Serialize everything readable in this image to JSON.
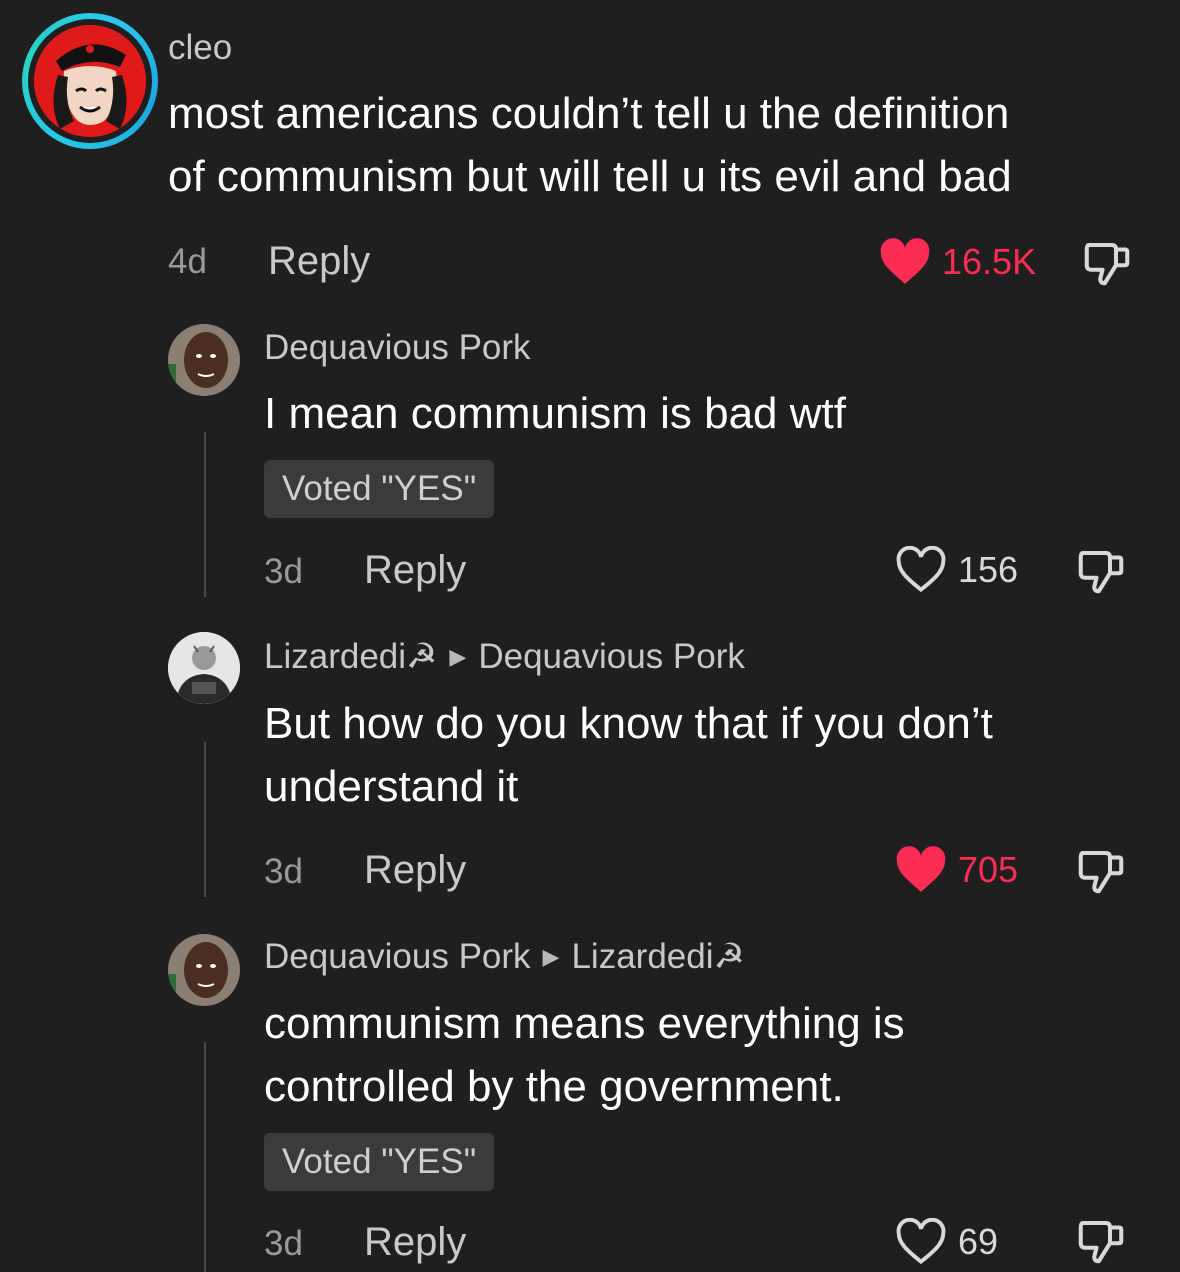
{
  "colors": {
    "background": "#1f1f1f",
    "like_active": "#fe2c55",
    "ring": "#25c8e8"
  },
  "comments": [
    {
      "username": "cleo",
      "lines": [
        "most americans couldn’t tell u the definition",
        "of communism but will tell u its evil and bad"
      ],
      "time": "4d",
      "reply": "Reply",
      "likes": "16.5K",
      "liked": true
    },
    {
      "username": "Dequavious Pork",
      "lines": [
        "I mean communism is bad wtf"
      ],
      "badge": "Voted \"YES\"",
      "time": "3d",
      "reply": "Reply",
      "likes": "156",
      "liked": false
    },
    {
      "username": "Lizardedi☭",
      "reply_to": "Dequavious Pork",
      "lines": [
        "But how do you know that if you don’t",
        "understand it"
      ],
      "time": "3d",
      "reply": "Reply",
      "likes": "705",
      "liked": true
    },
    {
      "username": "Dequavious Pork",
      "reply_to": "Lizardedi☭",
      "lines": [
        "communism means everything is",
        "controlled by the government."
      ],
      "badge": "Voted \"YES\"",
      "time": "3d",
      "reply": "Reply",
      "likes": "69",
      "liked": false
    }
  ],
  "icons": {
    "like": "heart-icon",
    "dislike": "thumbs-down-icon",
    "reply_arrow": "triangle-right-icon"
  }
}
